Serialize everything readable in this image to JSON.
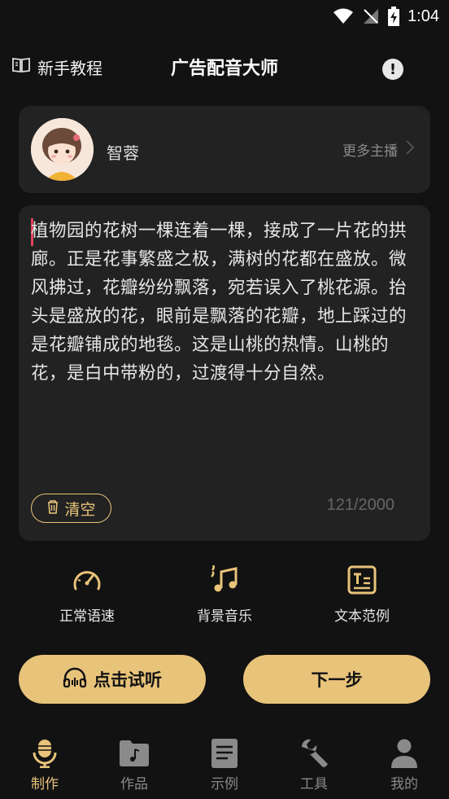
{
  "status_bar": {
    "time": "1:04"
  },
  "header": {
    "tutorial_label": "新手教程",
    "title": "广告配音大师"
  },
  "anchor": {
    "name": "智蓉",
    "more_label": "更多主播"
  },
  "editor": {
    "text": "植物园的花树一棵连着一棵，接成了一片花的拱廊。正是花事繁盛之极，满树的花都在盛放。微风拂过，花瓣纷纷飘落，宛若误入了桃花源。抬头是盛放的花，眼前是飘落的花瓣，地上踩过的是花瓣铺成的地毯。这是山桃的热情。山桃的花，是白中带粉的，过渡得十分自然。",
    "clear_label": "清空",
    "counter": "121/2000"
  },
  "tools": [
    {
      "label": "正常语速",
      "icon": "speedometer-icon"
    },
    {
      "label": "背景音乐",
      "icon": "music-note-icon"
    },
    {
      "label": "文本范例",
      "icon": "text-sample-icon"
    }
  ],
  "actions": {
    "preview_label": "点击试听",
    "next_label": "下一步"
  },
  "tabs": [
    {
      "label": "制作",
      "icon": "microphone-icon",
      "active": true
    },
    {
      "label": "作品",
      "icon": "folder-music-icon",
      "active": false
    },
    {
      "label": "示例",
      "icon": "document-icon",
      "active": false
    },
    {
      "label": "工具",
      "icon": "wrench-icon",
      "active": false
    },
    {
      "label": "我的",
      "icon": "user-icon",
      "active": false
    }
  ],
  "colors": {
    "accent": "#e8c37a",
    "background": "#121212",
    "card": "#222222",
    "cursor": "#e0455a"
  }
}
